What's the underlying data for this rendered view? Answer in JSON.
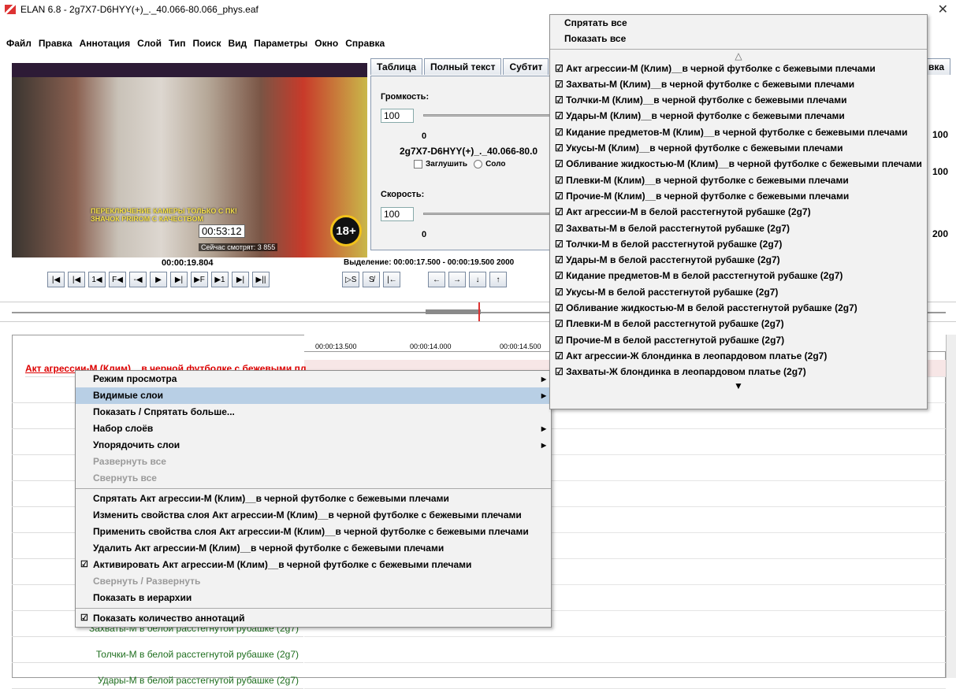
{
  "window": {
    "title": "ELAN 6.8 - 2g7X7-D6HYY(+)_._40.066-80.066_phys.eaf",
    "close": "✕"
  },
  "menubar": [
    "Файл",
    "Правка",
    "Аннотация",
    "Слой",
    "Тип",
    "Поиск",
    "Вид",
    "Параметры",
    "Окно",
    "Справка"
  ],
  "video": {
    "overlay_line1": "ПЕРЕКЛЮЧЕНИЕ КАМЕРЫ ТОЛЬКО С ПК!",
    "overlay_line2": "ЗНАЧОК PRIROM С КАЧЕСТВОМ",
    "stream_time": "00:53:12",
    "viewers": "Сейчас смотрят: 3 855",
    "age": "18+"
  },
  "player": {
    "current_time": "00:00:19.804",
    "selection": "Выделение: 00:00:17.500 - 00:00:19.500  2000",
    "buttons": [
      "|◀",
      "|◀",
      "1◀",
      "F◀",
      "-◀",
      "▶",
      "▶|",
      "▶F",
      "▶1",
      "▶|",
      "▶||"
    ],
    "sel_buttons": [
      "▷S",
      "S̸",
      "|←"
    ],
    "nav_buttons": [
      "←",
      "→",
      "↓",
      "↑"
    ]
  },
  "tabs": [
    "Таблица",
    "Полный текст",
    "Субтит"
  ],
  "tab_right": "вка",
  "controls": {
    "volume_label": "Громкость:",
    "volume_value": "100",
    "volume_tick": "0",
    "media_name": "2g7X7-D6HYY(+)_._40.066-80.0",
    "mute_label": "Заглушить",
    "solo_label": "Соло",
    "speed_label": "Скорость:",
    "speed_value": "100",
    "speed_tick": "0",
    "right_values": [
      "100",
      "100",
      "200"
    ]
  },
  "ruler": {
    "ticks": [
      "00:00:13.500",
      "00:00:14.000",
      "00:00:14.500"
    ]
  },
  "tiers": [
    {
      "label": "Акт агрессии-М (Клим)__в черной футболке с бежевыми пл",
      "style": "active"
    },
    {
      "label": "Захваты-М",
      "style": "green"
    },
    {
      "label": "Толчки-М",
      "style": "green"
    },
    {
      "label": "Удары-М",
      "style": "green"
    },
    {
      "label": "Кидание пр",
      "style": "green"
    },
    {
      "label": "Укусы-М",
      "style": "green"
    },
    {
      "label": "Обливание",
      "style": "green"
    },
    {
      "label": "Плевки-М",
      "style": "green"
    },
    {
      "label": "Прочие-М",
      "style": "green"
    },
    {
      "label": "А",
      "style": "green"
    },
    {
      "label": "Захваты-М в белой расстегнутой рубашке (2g7)",
      "style": "green"
    },
    {
      "label": "Толчки-М в белой расстегнутой рубашке (2g7)",
      "style": "green"
    },
    {
      "label": "Удары-М в белой расстегнутой рубашке (2g7)",
      "style": "green"
    }
  ],
  "context_menu": {
    "items": [
      {
        "label": "Режим просмотра",
        "sub": true
      },
      {
        "label": "Видимые слои",
        "sub": true,
        "selected": true
      },
      {
        "label": "Показать / Спрятать больше..."
      },
      {
        "label": "Набор слоёв",
        "sub": true
      },
      {
        "label": "Упорядочить слои",
        "sub": true
      },
      {
        "label": "Развернуть все",
        "disabled": true
      },
      {
        "label": "Свернуть все",
        "disabled": true
      },
      {
        "sep": true
      },
      {
        "label": "Спрятать Акт агрессии-М (Клим)__в черной футболке с бежевыми плечами"
      },
      {
        "label": "Изменить свойства слоя Акт агрессии-М (Клим)__в черной футболке с бежевыми плечами"
      },
      {
        "label": "Применить свойства слоя Акт агрессии-М (Клим)__в черной футболке с бежевыми плечами"
      },
      {
        "label": "Удалить Акт агрессии-М (Клим)__в черной футболке с бежевыми плечами"
      },
      {
        "label": "Активировать Акт агрессии-М (Клим)__в черной футболке с бежевыми плечами",
        "checked": true
      },
      {
        "label": "Свернуть / Развернуть",
        "disabled": true
      },
      {
        "label": "Показать в иерархии"
      },
      {
        "sep": true
      },
      {
        "label": "Показать количество аннотаций",
        "checked": true
      }
    ]
  },
  "submenu": {
    "hide_all": "Спрятать все",
    "show_all": "Показать все",
    "scroll_up": "△",
    "scroll_down": "▼",
    "layers": [
      "Акт агрессии-М (Клим)__в черной футболке с бежевыми плечами",
      "Захваты-М (Клим)__в черной футболке с бежевыми плечами",
      "Толчки-М (Клим)__в черной футболке с бежевыми плечами",
      "Удары-М (Клим)__в черной футболке с бежевыми плечами",
      "Кидание предметов-М (Клим)__в черной футболке с бежевыми плечами",
      "Укусы-М (Клим)__в черной футболке с бежевыми плечами",
      "Обливание жидкостью-М (Клим)__в черной футболке с бежевыми плечами",
      "Плевки-М (Клим)__в черной футболке с бежевыми плечами",
      "Прочие-М (Клим)__в черной футболке с бежевыми плечами",
      "Акт агрессии-М в белой расстегнутой рубашке (2g7)",
      "Захваты-М в белой расстегнутой рубашке (2g7)",
      "Толчки-М в белой расстегнутой рубашке (2g7)",
      "Удары-М в белой расстегнутой рубашке (2g7)",
      "Кидание предметов-М в белой расстегнутой рубашке (2g7)",
      "Укусы-М в белой расстегнутой рубашке (2g7)",
      "Обливание жидкостью-М в белой расстегнутой рубашке (2g7)",
      "Плевки-М в белой расстегнутой рубашке (2g7)",
      "Прочие-М в белой расстегнутой рубашке (2g7)",
      "Акт агрессии-Ж блондинка в леопардовом платье (2g7)",
      "Захваты-Ж блондинка в леопардовом платье (2g7)"
    ]
  }
}
